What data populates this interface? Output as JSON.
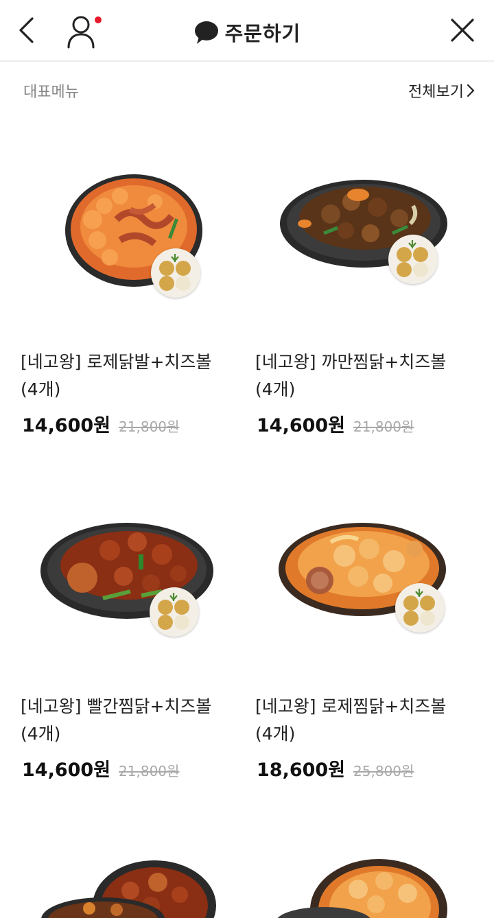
{
  "header": {
    "title": "주문하기",
    "icons": [
      "back-icon",
      "user-icon",
      "chat-bubble-icon",
      "close-icon"
    ],
    "notification_color": "#e8192c"
  },
  "section": {
    "title": "대표메뉴",
    "see_all": "전체보기"
  },
  "menu_items": [
    {
      "name_line1": "[네고왕] 로제닭발+치즈볼",
      "name_line2": "(4개)",
      "price": "14,600원",
      "original_price": "21,800원"
    },
    {
      "name_line1": "[네고왕] 까만찜닭+치즈볼",
      "name_line2": "(4개)",
      "price": "14,600원",
      "original_price": "21,800원"
    },
    {
      "name_line1": "[네고왕] 빨간찜닭+치즈볼",
      "name_line2": "(4개)",
      "price": "14,600원",
      "original_price": "21,800원"
    },
    {
      "name_line1": "[네고왕] 로제찜닭+치즈볼",
      "name_line2": "(4개)",
      "price": "18,600원",
      "original_price": "25,800원"
    }
  ]
}
